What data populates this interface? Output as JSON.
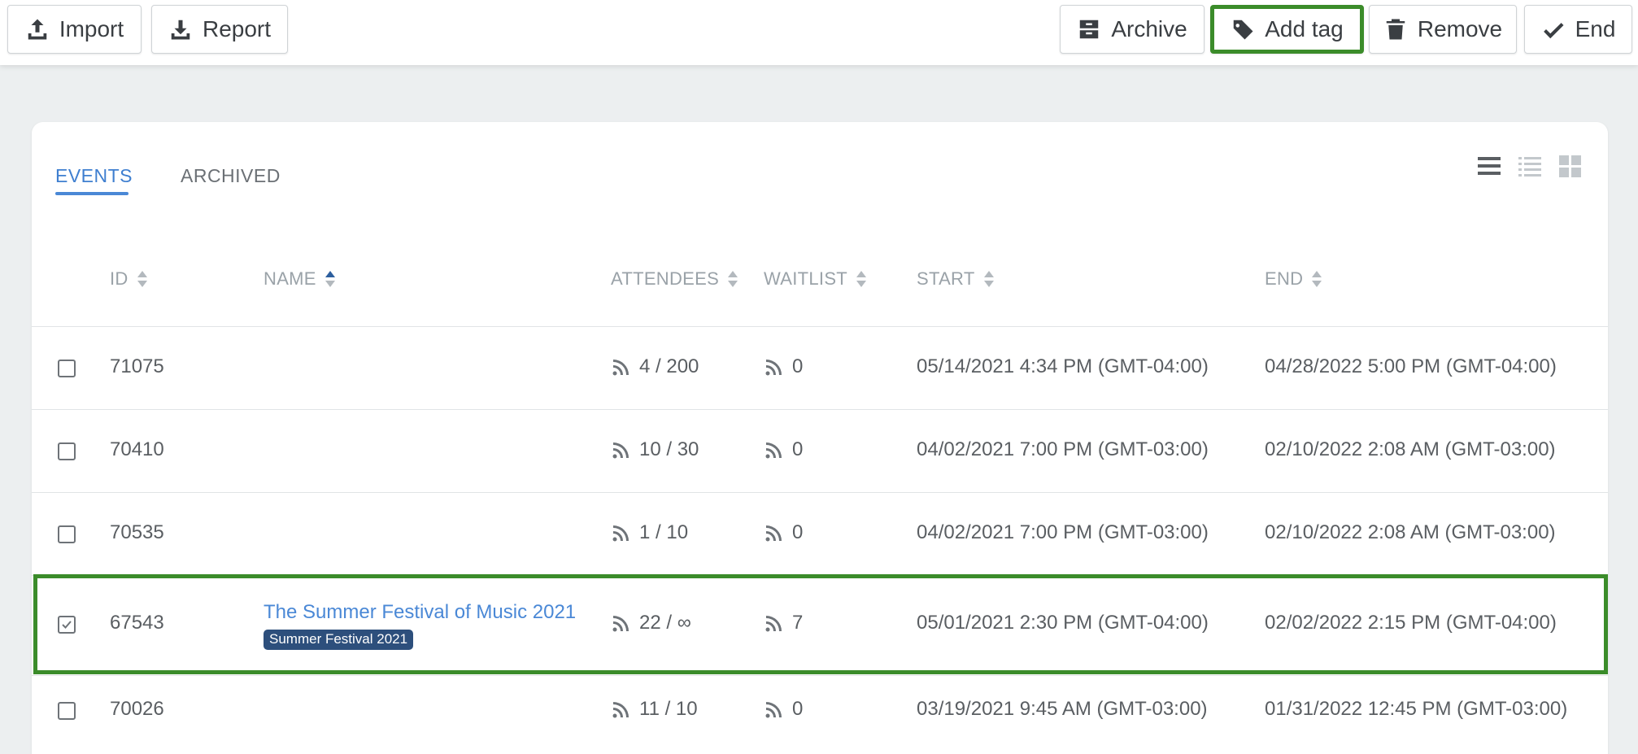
{
  "toolbar": {
    "import_label": "Import",
    "report_label": "Report",
    "archive_label": "Archive",
    "add_tag_label": "Add tag",
    "remove_label": "Remove",
    "end_label": "End"
  },
  "tabs": [
    {
      "label": "EVENTS",
      "active": true
    },
    {
      "label": "ARCHIVED",
      "active": false
    }
  ],
  "view_icons": [
    "list-view-icon",
    "detailed-list-view-icon",
    "grid-view-icon"
  ],
  "columns": {
    "id": "ID",
    "name": "NAME",
    "attendees": "ATTENDEES",
    "waitlist": "WAITLIST",
    "start": "START",
    "end": "END"
  },
  "rows": [
    {
      "id": "71075",
      "name": "",
      "tag": "",
      "attendees": "4 / 200",
      "waitlist": "0",
      "start": "05/14/2021 4:34 PM (GMT-04:00)",
      "end": "04/28/2022 5:00 PM (GMT-04:00)",
      "checked": false
    },
    {
      "id": "70410",
      "name": "",
      "tag": "",
      "attendees": "10 / 30",
      "waitlist": "0",
      "start": "04/02/2021 7:00 PM (GMT-03:00)",
      "end": "02/10/2022 2:08 AM (GMT-03:00)",
      "checked": false
    },
    {
      "id": "70535",
      "name": "",
      "tag": "",
      "attendees": "1 / 10",
      "waitlist": "0",
      "start": "04/02/2021 7:00 PM (GMT-03:00)",
      "end": "02/10/2022 2:08 AM (GMT-03:00)",
      "checked": false
    },
    {
      "id": "67543",
      "name": "The Summer Festival of Music 2021",
      "tag": "Summer Festival 2021",
      "attendees": "22 / ∞",
      "waitlist": "7",
      "start": "05/01/2021 2:30 PM (GMT-04:00)",
      "end": "02/02/2022 2:15 PM (GMT-04:00)",
      "checked": true
    },
    {
      "id": "70026",
      "name": "",
      "tag": "",
      "attendees": "11 / 10",
      "waitlist": "0",
      "start": "03/19/2021 9:45 AM (GMT-03:00)",
      "end": "01/31/2022 12:45 PM (GMT-03:00)",
      "checked": false
    }
  ],
  "colors": {
    "highlight": "#3b8c2a",
    "link": "#4a88d6",
    "tag_bg": "#2d4f7c"
  }
}
